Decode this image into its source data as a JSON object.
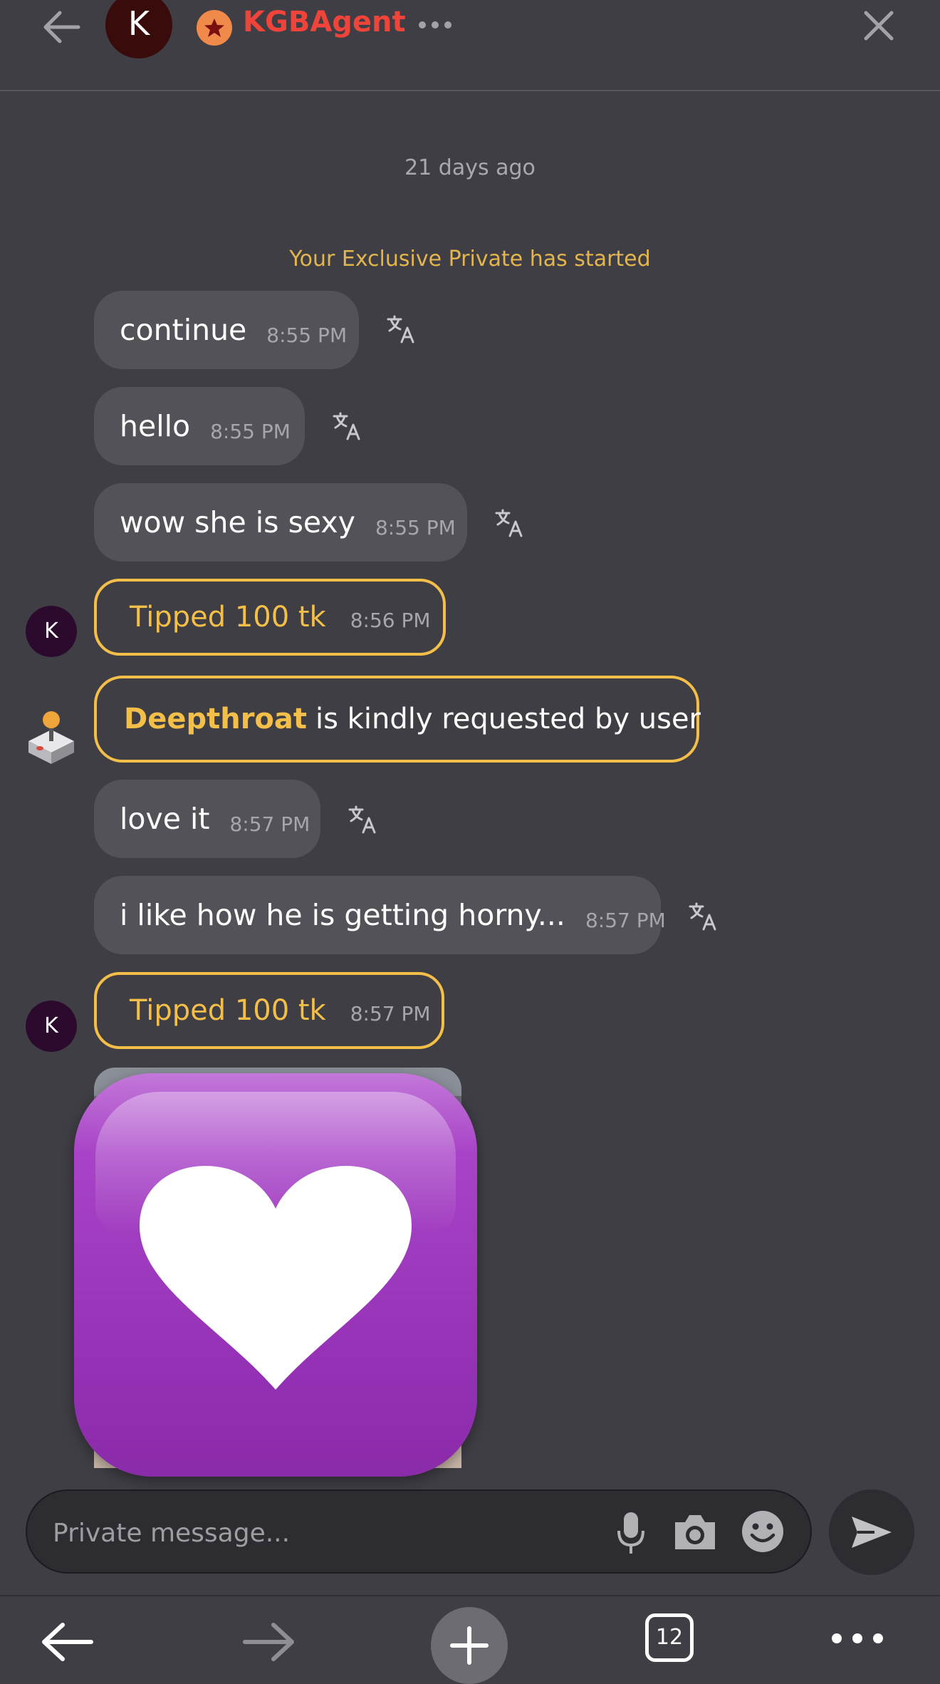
{
  "header": {
    "avatar_letter": "K",
    "username": "KGBAgent",
    "more_icon": "more-horizontal-icon",
    "close_icon": "close-icon",
    "back_icon": "arrow-left-icon"
  },
  "chat": {
    "date_separator": "21 days ago",
    "system_note": "Your Exclusive Private has started",
    "messages": [
      {
        "text": "continue",
        "time": "8:55 PM"
      },
      {
        "text": "hello",
        "time": "8:55 PM"
      },
      {
        "text": "wow she is sexy",
        "time": "8:55 PM"
      },
      {
        "text": "love it",
        "time": "8:57 PM"
      },
      {
        "text": "i like how he is getting horny...",
        "time": "8:57 PM"
      }
    ],
    "tips": [
      {
        "text": "Tipped 100 tk",
        "time": "8:56 PM",
        "avatar": "K"
      },
      {
        "text": "Tipped 100 tk",
        "time": "8:57 PM",
        "avatar": "K"
      }
    ],
    "request": {
      "action": "Deepthroat",
      "text": "is kindly requested by user",
      "icon": "joystick-icon"
    },
    "image_overlay_icon": "purple-heart-emoji"
  },
  "composer": {
    "placeholder": "Private message...",
    "mic_icon": "microphone-icon",
    "camera_icon": "camera-icon",
    "emoji_icon": "smiley-icon",
    "send_icon": "send-icon"
  },
  "browser_bar": {
    "tab_count": "12"
  },
  "colors": {
    "background": "#3f3e44",
    "bubble": "#535258",
    "accent_yellow": "#f3bf49",
    "username_red": "#f0443a"
  }
}
